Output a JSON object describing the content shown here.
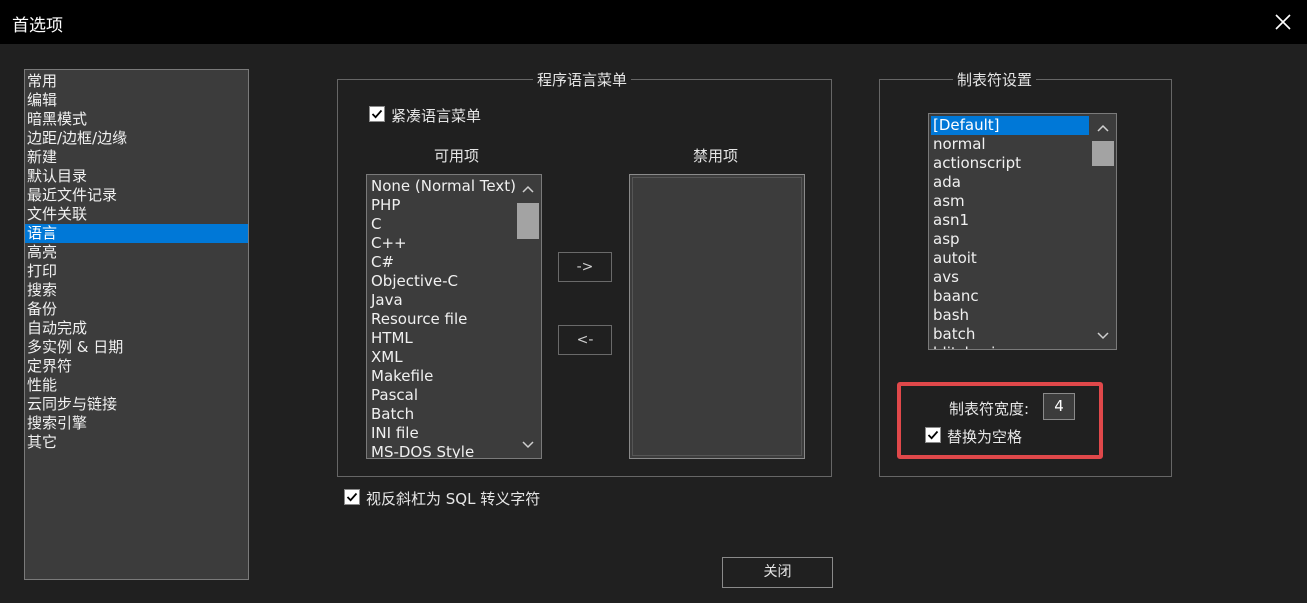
{
  "window": {
    "title": "首选项"
  },
  "categories": [
    {
      "label": "常用"
    },
    {
      "label": "编辑"
    },
    {
      "label": "暗黑模式"
    },
    {
      "label": "边距/边框/边缘"
    },
    {
      "label": "新建"
    },
    {
      "label": "默认目录"
    },
    {
      "label": "最近文件记录"
    },
    {
      "label": "文件关联"
    },
    {
      "label": "语言",
      "selected": true
    },
    {
      "label": "高亮"
    },
    {
      "label": "打印"
    },
    {
      "label": "搜索"
    },
    {
      "label": "备份"
    },
    {
      "label": "自动完成"
    },
    {
      "label": "多实例 & 日期"
    },
    {
      "label": "定界符"
    },
    {
      "label": "性能"
    },
    {
      "label": "云同步与链接"
    },
    {
      "label": "搜索引擎"
    },
    {
      "label": "其它"
    }
  ],
  "language_menu": {
    "title": "程序语言菜单",
    "compact_label": "紧凑语言菜单",
    "compact_checked": true,
    "available_header": "可用项",
    "disabled_header": "禁用项",
    "available": [
      "None (Normal Text)",
      "PHP",
      "C",
      "C++",
      "C#",
      "Objective-C",
      "Java",
      "Resource file",
      "HTML",
      "XML",
      "Makefile",
      "Pascal",
      "Batch",
      "INI file",
      "MS-DOS Style"
    ],
    "disabled": [],
    "move_right_label": "->",
    "move_left_label": "<-"
  },
  "sql_escape": {
    "label": "视反斜杠为 SQL 转义字符",
    "checked": true
  },
  "tab_settings": {
    "title": "制表符设置",
    "languages": [
      "[Default]",
      "normal",
      "actionscript",
      "ada",
      "asm",
      "asn1",
      "asp",
      "autoit",
      "avs",
      "baanc",
      "bash",
      "batch",
      "blitzbasic"
    ],
    "selected_index": 0,
    "tab_width_label": "制表符宽度:",
    "tab_width_value": "4",
    "replace_label": "替换为空格",
    "replace_checked": true,
    "highlight_color": "#e0484a"
  },
  "close_button": {
    "label": "关闭"
  },
  "icons": {
    "close": "close-icon",
    "check": "check-icon",
    "scroll_up": "chevron-up-icon",
    "scroll_down": "chevron-down-icon"
  }
}
